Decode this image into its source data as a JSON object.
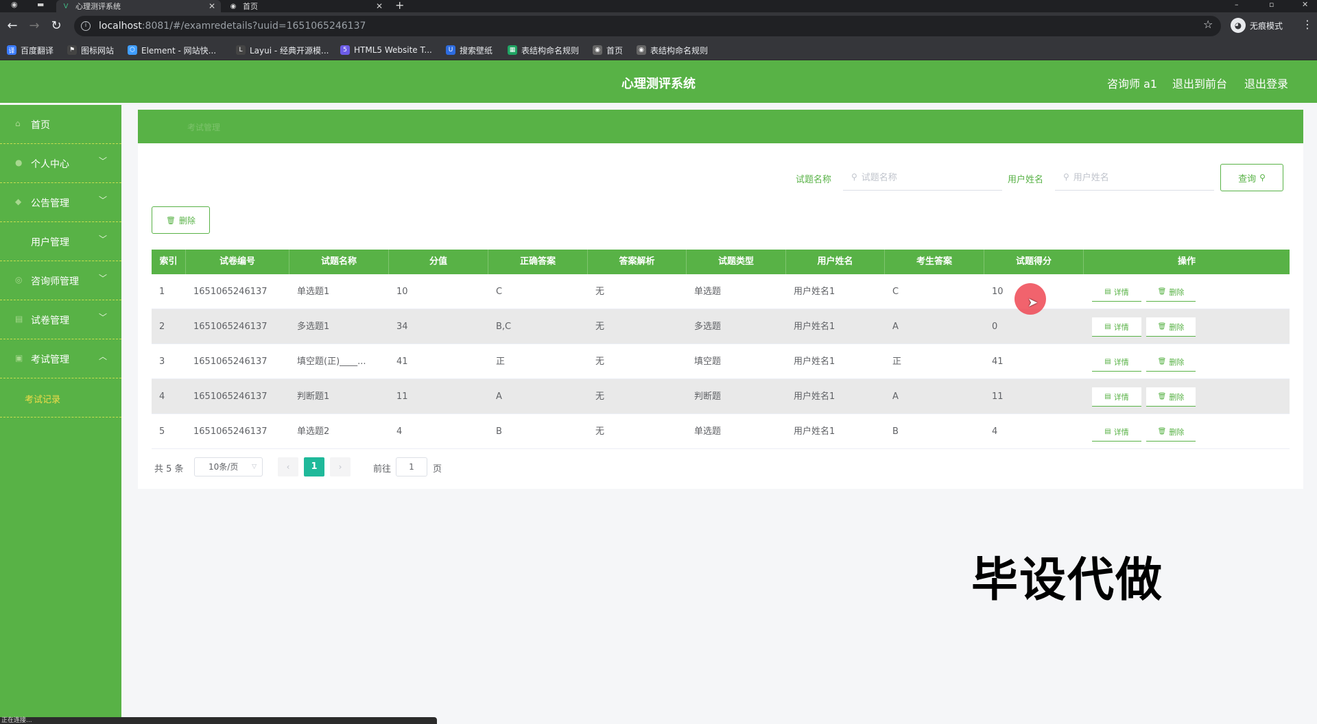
{
  "browser": {
    "tabs": [
      {
        "title": "心理测评系统",
        "active": true
      },
      {
        "title": "首页",
        "active": false
      }
    ],
    "url_host": "localhost",
    "url_rest": ":8081/#/examredetails?uuid=1651065246137",
    "incognito_label": "无痕模式",
    "bookmarks": [
      {
        "label": "百度翻译",
        "icon": "translate-icon",
        "color": "#3b7cff"
      },
      {
        "label": "图标网站",
        "icon": "flag-icon",
        "color": "#444"
      },
      {
        "label": "Element - 网站快...",
        "icon": "element-icon",
        "color": "#409eff"
      },
      {
        "label": "Layui - 经典开源模...",
        "icon": "layui-icon",
        "color": "#444"
      },
      {
        "label": "HTML5 Website T...",
        "icon": "html5-icon",
        "color": "#6c5ce7"
      },
      {
        "label": "搜索壁纸",
        "icon": "wallpaper-icon",
        "color": "#2d6cdf"
      },
      {
        "label": "表结构命名规则",
        "icon": "sheet-icon",
        "color": "#1fa463"
      },
      {
        "label": "首页",
        "icon": "globe-icon",
        "color": "#666"
      },
      {
        "label": "表结构命名规则",
        "icon": "globe-icon",
        "color": "#666"
      }
    ]
  },
  "header": {
    "title": "心理测评系统",
    "user": "咨询师 a1",
    "to_front": "退出到前台",
    "logout": "退出登录"
  },
  "sidebar": {
    "items": [
      {
        "label": "首页",
        "icon": "home-icon",
        "arrow": ""
      },
      {
        "label": "个人中心",
        "icon": "person-icon",
        "arrow": "﹀"
      },
      {
        "label": "公告管理",
        "icon": "notice-icon",
        "arrow": "﹀"
      },
      {
        "label": "用户管理",
        "icon": "",
        "arrow": "﹀"
      },
      {
        "label": "咨询师管理",
        "icon": "counselor-icon",
        "arrow": "﹀"
      },
      {
        "label": "试卷管理",
        "icon": "paper-icon",
        "arrow": "﹀"
      },
      {
        "label": "考试管理",
        "icon": "exam-icon",
        "arrow": "︿"
      }
    ],
    "sub_item": "考试记录"
  },
  "breadcrumb": "考试管理",
  "search": {
    "label1": "试题名称",
    "placeholder1": "试题名称",
    "label2": "用户姓名",
    "placeholder2": "用户姓名",
    "query_label": "查询"
  },
  "delete_label": "删除",
  "table": {
    "columns": [
      "索引",
      "试卷编号",
      "试题名称",
      "分值",
      "正确答案",
      "答案解析",
      "试题类型",
      "用户姓名",
      "考生答案",
      "试题得分",
      "操作"
    ],
    "rows": [
      [
        "1",
        "1651065246137",
        "单选题1",
        "10",
        "C",
        "无",
        "单选题",
        "用户姓名1",
        "C",
        "10"
      ],
      [
        "2",
        "1651065246137",
        "多选题1",
        "34",
        "B,C",
        "无",
        "多选题",
        "用户姓名1",
        "A",
        "0"
      ],
      [
        "3",
        "1651065246137",
        "填空题(正)____...",
        "41",
        "正",
        "无",
        "填空题",
        "用户姓名1",
        "正",
        "41"
      ],
      [
        "4",
        "1651065246137",
        "判断题1",
        "11",
        "A",
        "无",
        "判断题",
        "用户姓名1",
        "A",
        "11"
      ],
      [
        "5",
        "1651065246137",
        "单选题2",
        "4",
        "B",
        "无",
        "单选题",
        "用户姓名1",
        "B",
        "4"
      ]
    ],
    "detail_label": "详情",
    "delete_label": "删除"
  },
  "pagination": {
    "total": "共 5 条",
    "page_size": "10条/页",
    "current": "1",
    "goto_label": "前往",
    "goto_value": "1",
    "page_suffix": "页"
  },
  "watermark": "毕设代做",
  "status_text": "正在连接..."
}
